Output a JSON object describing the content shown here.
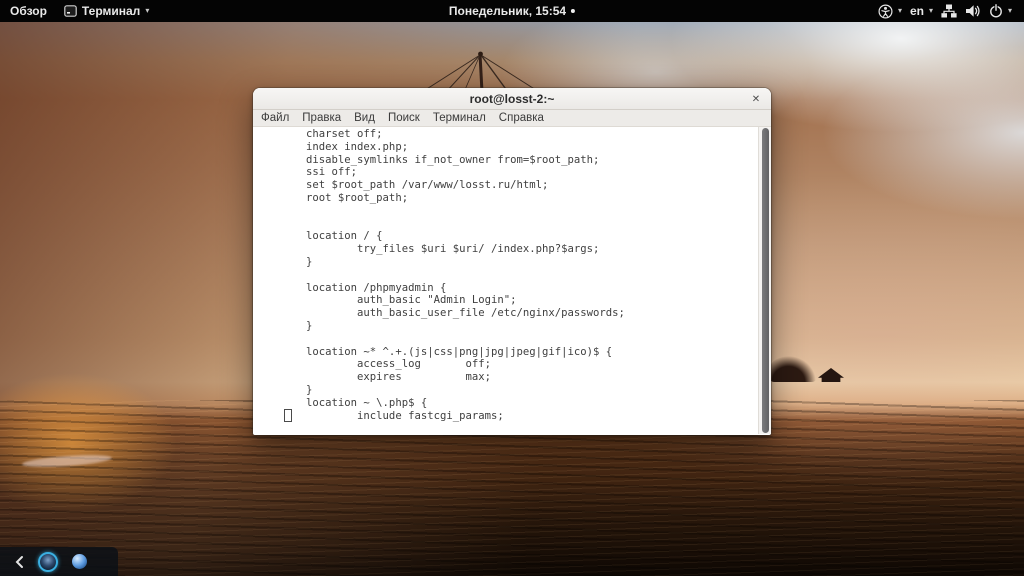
{
  "topbar": {
    "activities": "Обзор",
    "app_menu": "Терминал",
    "clock": "Понедельник, 15:54",
    "language": "en"
  },
  "window": {
    "title": "root@losst-2:~",
    "close": "✕",
    "menus": [
      "Файл",
      "Правка",
      "Вид",
      "Поиск",
      "Терминал",
      "Справка"
    ],
    "terminal_lines": [
      "        charset off;",
      "        index index.php;",
      "        disable_symlinks if_not_owner from=$root_path;",
      "        ssi off;",
      "        set $root_path /var/www/losst.ru/html;",
      "        root $root_path;",
      "",
      "",
      "        location / {",
      "                try_files $uri $uri/ /index.php?$args;",
      "        }",
      "",
      "        location /phpmyadmin {",
      "                auth_basic \"Admin Login\";",
      "                auth_basic_user_file /etc/nginx/passwords;",
      "        }",
      "",
      "        location ~* ^.+.(js|css|png|jpg|jpeg|gif|ico)$ {",
      "                access_log       off;",
      "                expires          max;",
      "        }",
      "        location ~ \\.php$ {",
      "                include fastcgi_params;"
    ]
  },
  "colors": {
    "topbar_bg": "#040404",
    "terminal_bg": "#ffffff",
    "terminal_fg": "#404040",
    "titlebar_bg": "#f1efec",
    "dock_accent": "#3ab0e2",
    "sunset_orange": "#a55f32",
    "sky_blue_gray": "#95a1b0"
  }
}
